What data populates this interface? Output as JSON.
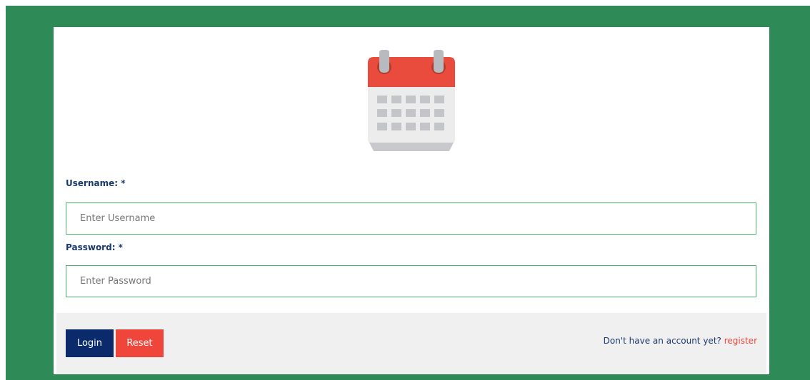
{
  "colors": {
    "frame": "#2e8b57",
    "card": "#ffffff",
    "label_text": "#1a3a6b",
    "input_border": "#4caf6a",
    "footer_bg": "#f0f0f0",
    "login_button": "#0b2a6b",
    "reset_button": "#f0453a",
    "register_link": "#f0453a"
  },
  "logo": {
    "icon": "calendar-icon"
  },
  "form": {
    "username": {
      "label": "Username: *",
      "placeholder": "Enter Username",
      "value": ""
    },
    "password": {
      "label": "Password: *",
      "placeholder": "Enter Password",
      "value": ""
    }
  },
  "footer": {
    "login_label": "Login",
    "reset_label": "Reset",
    "register_prompt": "Don't have an account yet?",
    "register_link": "register"
  }
}
